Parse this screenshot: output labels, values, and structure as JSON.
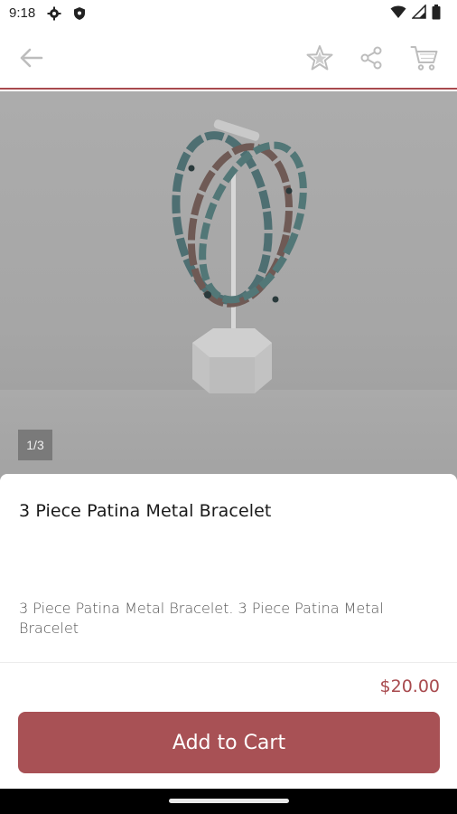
{
  "status_bar": {
    "time": "9:18",
    "icons": [
      "gear-icon",
      "shield-icon",
      "wifi-icon",
      "signal-icon",
      "battery-icon"
    ]
  },
  "app_bar": {
    "back_icon": "arrow-left-icon",
    "actions": [
      "star-icon",
      "share-icon",
      "cart-icon"
    ],
    "accent": "#a84a4e"
  },
  "gallery": {
    "page_indicator": "1/3",
    "current": 1,
    "total": 3
  },
  "product": {
    "title": "3 Piece Patina Metal Bracelet",
    "description": "3 Piece Patina Metal Bracelet. 3 Piece Patina Metal Bracelet",
    "price": "$20.00"
  },
  "actions": {
    "add_to_cart_label": "Add to Cart",
    "button_color": "#a85155"
  }
}
